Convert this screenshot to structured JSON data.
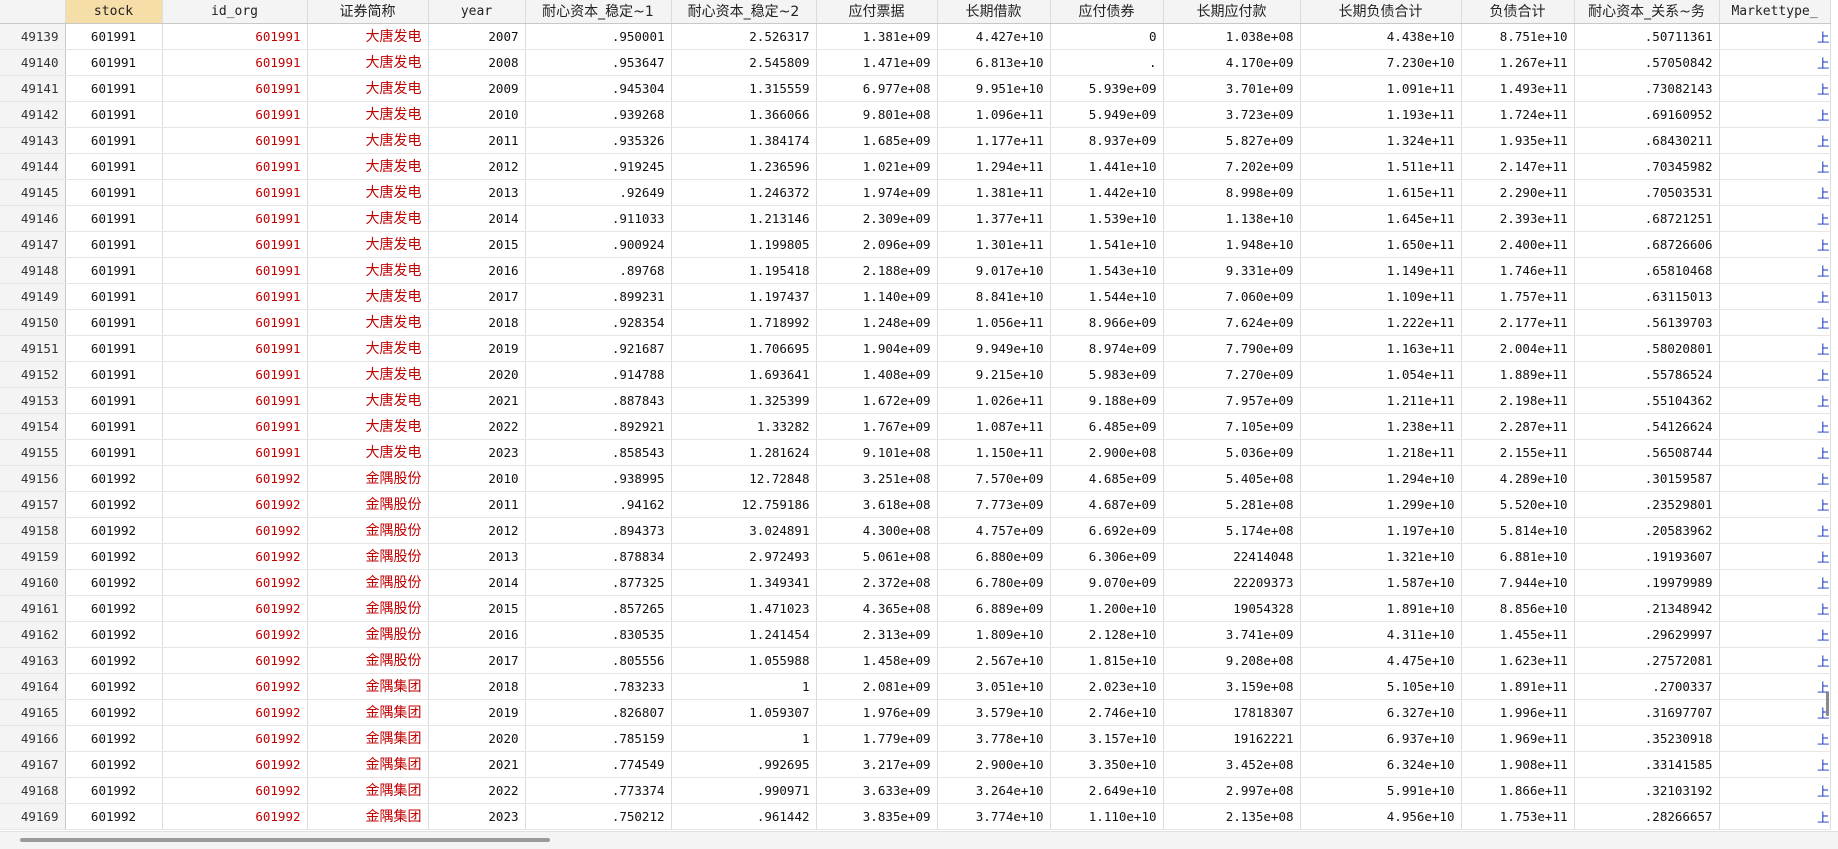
{
  "headers": [
    "stock",
    "id_org",
    "证券简称",
    "year",
    "耐心资本_稳定~1",
    "耐心资本_稳定~2",
    "应付票据",
    "长期借款",
    "应付债券",
    "长期应付款",
    "长期负债合计",
    "负债合计",
    "耐心资本_关系~务",
    "Markettype_"
  ],
  "rows": [
    [
      "49139",
      "601991",
      "601991",
      "大唐发电",
      "2007",
      ".950001",
      "2.526317",
      "1.381e+09",
      "4.427e+10",
      "0",
      "1.038e+08",
      "4.438e+10",
      "8.751e+10",
      ".50711361",
      "上"
    ],
    [
      "49140",
      "601991",
      "601991",
      "大唐发电",
      "2008",
      ".953647",
      "2.545809",
      "1.471e+09",
      "6.813e+10",
      ".",
      "4.170e+09",
      "7.230e+10",
      "1.267e+11",
      ".57050842",
      "上"
    ],
    [
      "49141",
      "601991",
      "601991",
      "大唐发电",
      "2009",
      ".945304",
      "1.315559",
      "6.977e+08",
      "9.951e+10",
      "5.939e+09",
      "3.701e+09",
      "1.091e+11",
      "1.493e+11",
      ".73082143",
      "上"
    ],
    [
      "49142",
      "601991",
      "601991",
      "大唐发电",
      "2010",
      ".939268",
      "1.366066",
      "9.801e+08",
      "1.096e+11",
      "5.949e+09",
      "3.723e+09",
      "1.193e+11",
      "1.724e+11",
      ".69160952",
      "上"
    ],
    [
      "49143",
      "601991",
      "601991",
      "大唐发电",
      "2011",
      ".935326",
      "1.384174",
      "1.685e+09",
      "1.177e+11",
      "8.937e+09",
      "5.827e+09",
      "1.324e+11",
      "1.935e+11",
      ".68430211",
      "上"
    ],
    [
      "49144",
      "601991",
      "601991",
      "大唐发电",
      "2012",
      ".919245",
      "1.236596",
      "1.021e+09",
      "1.294e+11",
      "1.441e+10",
      "7.202e+09",
      "1.511e+11",
      "2.147e+11",
      ".70345982",
      "上"
    ],
    [
      "49145",
      "601991",
      "601991",
      "大唐发电",
      "2013",
      ".92649",
      "1.246372",
      "1.974e+09",
      "1.381e+11",
      "1.442e+10",
      "8.998e+09",
      "1.615e+11",
      "2.290e+11",
      ".70503531",
      "上"
    ],
    [
      "49146",
      "601991",
      "601991",
      "大唐发电",
      "2014",
      ".911033",
      "1.213146",
      "2.309e+09",
      "1.377e+11",
      "1.539e+10",
      "1.138e+10",
      "1.645e+11",
      "2.393e+11",
      ".68721251",
      "上"
    ],
    [
      "49147",
      "601991",
      "601991",
      "大唐发电",
      "2015",
      ".900924",
      "1.199805",
      "2.096e+09",
      "1.301e+11",
      "1.541e+10",
      "1.948e+10",
      "1.650e+11",
      "2.400e+11",
      ".68726606",
      "上"
    ],
    [
      "49148",
      "601991",
      "601991",
      "大唐发电",
      "2016",
      ".89768",
      "1.195418",
      "2.188e+09",
      "9.017e+10",
      "1.543e+10",
      "9.331e+09",
      "1.149e+11",
      "1.746e+11",
      ".65810468",
      "上"
    ],
    [
      "49149",
      "601991",
      "601991",
      "大唐发电",
      "2017",
      ".899231",
      "1.197437",
      "1.140e+09",
      "8.841e+10",
      "1.544e+10",
      "7.060e+09",
      "1.109e+11",
      "1.757e+11",
      ".63115013",
      "上"
    ],
    [
      "49150",
      "601991",
      "601991",
      "大唐发电",
      "2018",
      ".928354",
      "1.718992",
      "1.248e+09",
      "1.056e+11",
      "8.966e+09",
      "7.624e+09",
      "1.222e+11",
      "2.177e+11",
      ".56139703",
      "上"
    ],
    [
      "49151",
      "601991",
      "601991",
      "大唐发电",
      "2019",
      ".921687",
      "1.706695",
      "1.904e+09",
      "9.949e+10",
      "8.974e+09",
      "7.790e+09",
      "1.163e+11",
      "2.004e+11",
      ".58020801",
      "上"
    ],
    [
      "49152",
      "601991",
      "601991",
      "大唐发电",
      "2020",
      ".914788",
      "1.693641",
      "1.408e+09",
      "9.215e+10",
      "5.983e+09",
      "7.270e+09",
      "1.054e+11",
      "1.889e+11",
      ".55786524",
      "上"
    ],
    [
      "49153",
      "601991",
      "601991",
      "大唐发电",
      "2021",
      ".887843",
      "1.325399",
      "1.672e+09",
      "1.026e+11",
      "9.188e+09",
      "7.957e+09",
      "1.211e+11",
      "2.198e+11",
      ".55104362",
      "上"
    ],
    [
      "49154",
      "601991",
      "601991",
      "大唐发电",
      "2022",
      ".892921",
      "1.33282",
      "1.767e+09",
      "1.087e+11",
      "6.485e+09",
      "7.105e+09",
      "1.238e+11",
      "2.287e+11",
      ".54126624",
      "上"
    ],
    [
      "49155",
      "601991",
      "601991",
      "大唐发电",
      "2023",
      ".858543",
      "1.281624",
      "9.101e+08",
      "1.150e+11",
      "2.900e+08",
      "5.036e+09",
      "1.218e+11",
      "2.155e+11",
      ".56508744",
      "上"
    ],
    [
      "49156",
      "601992",
      "601992",
      "金隅股份",
      "2010",
      ".938995",
      "12.72848",
      "3.251e+08",
      "7.570e+09",
      "4.685e+09",
      "5.405e+08",
      "1.294e+10",
      "4.289e+10",
      ".30159587",
      "上"
    ],
    [
      "49157",
      "601992",
      "601992",
      "金隅股份",
      "2011",
      ".94162",
      "12.759186",
      "3.618e+08",
      "7.773e+09",
      "4.687e+09",
      "5.281e+08",
      "1.299e+10",
      "5.520e+10",
      ".23529801",
      "上"
    ],
    [
      "49158",
      "601992",
      "601992",
      "金隅股份",
      "2012",
      ".894373",
      "3.024891",
      "4.300e+08",
      "4.757e+09",
      "6.692e+09",
      "5.174e+08",
      "1.197e+10",
      "5.814e+10",
      ".20583962",
      "上"
    ],
    [
      "49159",
      "601992",
      "601992",
      "金隅股份",
      "2013",
      ".878834",
      "2.972493",
      "5.061e+08",
      "6.880e+09",
      "6.306e+09",
      "22414048",
      "1.321e+10",
      "6.881e+10",
      ".19193607",
      "上"
    ],
    [
      "49160",
      "601992",
      "601992",
      "金隅股份",
      "2014",
      ".877325",
      "1.349341",
      "2.372e+08",
      "6.780e+09",
      "9.070e+09",
      "22209373",
      "1.587e+10",
      "7.944e+10",
      ".19979989",
      "上"
    ],
    [
      "49161",
      "601992",
      "601992",
      "金隅股份",
      "2015",
      ".857265",
      "1.471023",
      "4.365e+08",
      "6.889e+09",
      "1.200e+10",
      "19054328",
      "1.891e+10",
      "8.856e+10",
      ".21348942",
      "上"
    ],
    [
      "49162",
      "601992",
      "601992",
      "金隅股份",
      "2016",
      ".830535",
      "1.241454",
      "2.313e+09",
      "1.809e+10",
      "2.128e+10",
      "3.741e+09",
      "4.311e+10",
      "1.455e+11",
      ".29629997",
      "上"
    ],
    [
      "49163",
      "601992",
      "601992",
      "金隅股份",
      "2017",
      ".805556",
      "1.055988",
      "1.458e+09",
      "2.567e+10",
      "1.815e+10",
      "9.208e+08",
      "4.475e+10",
      "1.623e+11",
      ".27572081",
      "上"
    ],
    [
      "49164",
      "601992",
      "601992",
      "金隅集团",
      "2018",
      ".783233",
      "1",
      "2.081e+09",
      "3.051e+10",
      "2.023e+10",
      "3.159e+08",
      "5.105e+10",
      "1.891e+11",
      ".2700337",
      "上"
    ],
    [
      "49165",
      "601992",
      "601992",
      "金隅集团",
      "2019",
      ".826807",
      "1.059307",
      "1.976e+09",
      "3.579e+10",
      "2.746e+10",
      "17818307",
      "6.327e+10",
      "1.996e+11",
      ".31697707",
      "上"
    ],
    [
      "49166",
      "601992",
      "601992",
      "金隅集团",
      "2020",
      ".785159",
      "1",
      "1.779e+09",
      "3.778e+10",
      "3.157e+10",
      "19162221",
      "6.937e+10",
      "1.969e+11",
      ".35230918",
      "上"
    ],
    [
      "49167",
      "601992",
      "601992",
      "金隅集团",
      "2021",
      ".774549",
      ".992695",
      "3.217e+09",
      "2.900e+10",
      "3.350e+10",
      "3.452e+08",
      "6.324e+10",
      "1.908e+11",
      ".33141585",
      "上"
    ],
    [
      "49168",
      "601992",
      "601992",
      "金隅集团",
      "2022",
      ".773374",
      ".990971",
      "3.633e+09",
      "3.264e+10",
      "2.649e+10",
      "2.997e+08",
      "5.991e+10",
      "1.866e+11",
      ".32103192",
      "上"
    ],
    [
      "49169",
      "601992",
      "601992",
      "金隅集团",
      "2023",
      ".750212",
      ".961442",
      "3.835e+09",
      "3.774e+10",
      "1.110e+10",
      "2.135e+08",
      "4.956e+10",
      "1.753e+11",
      ".28266657",
      "上"
    ]
  ]
}
